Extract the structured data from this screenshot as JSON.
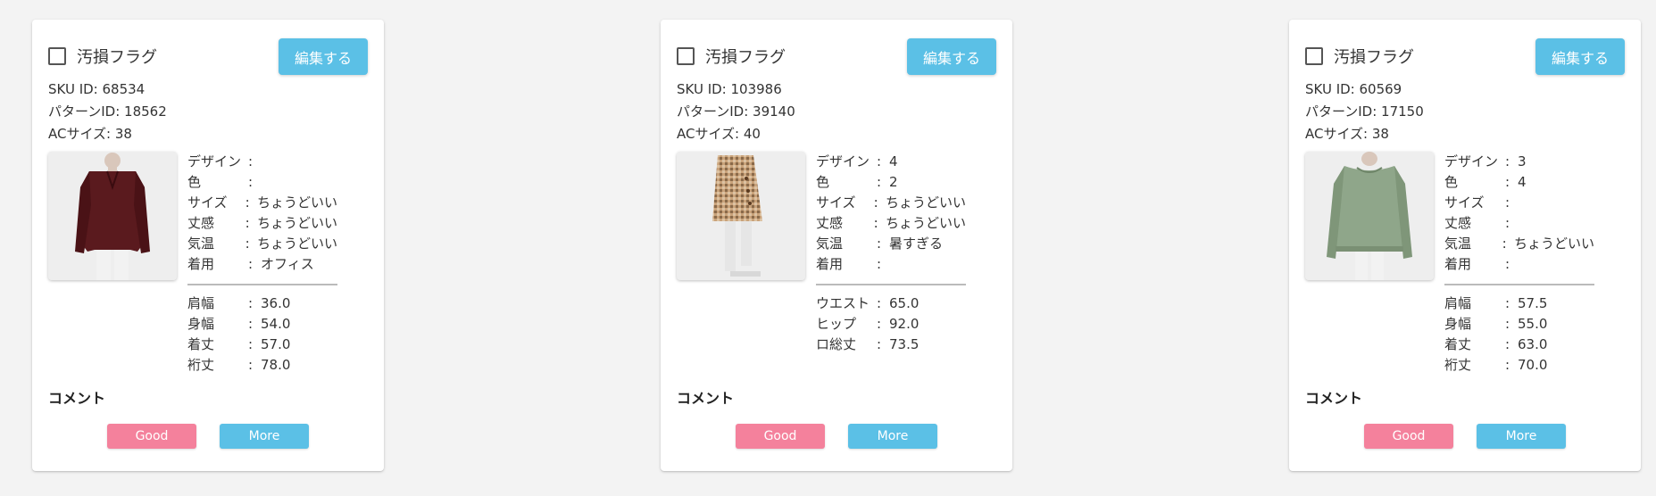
{
  "accent_colors": {
    "edit": "#5bc0e6",
    "good": "#f4819c",
    "more": "#5bc0e6"
  },
  "cards": [
    {
      "flag_label": "汚損フラグ",
      "flag_checked": false,
      "edit_label": "編集する",
      "sku": "SKU ID: 68534",
      "pattern": "パターンID: 18562",
      "ac_size": "ACサイズ: 38",
      "image": "burgundy-blouse-photo",
      "attributes": [
        {
          "key": "デザイン",
          "colon": ":",
          "value": ""
        },
        {
          "key": "色",
          "colon": ":",
          "value": ""
        },
        {
          "key": "サイズ",
          "colon": ":",
          "value": "ちょうどいい"
        },
        {
          "key": "丈感",
          "colon": ":",
          "value": "ちょうどいい"
        },
        {
          "key": "気温",
          "colon": ":",
          "value": "ちょうどいい"
        },
        {
          "key": "着用",
          "colon": ":",
          "value": "オフィス"
        }
      ],
      "measurements": [
        {
          "key": "肩幅",
          "colon": ":",
          "value": "36.0"
        },
        {
          "key": "身幅",
          "colon": ":",
          "value": "54.0"
        },
        {
          "key": "着丈",
          "colon": ":",
          "value": "57.0"
        },
        {
          "key": "裄丈",
          "colon": ":",
          "value": "78.0"
        }
      ],
      "comment_label": "コメント",
      "good_label": "Good",
      "more_label": "More"
    },
    {
      "flag_label": "汚損フラグ",
      "flag_checked": false,
      "edit_label": "編集する",
      "sku": "SKU ID: 103986",
      "pattern": "パターンID: 39140",
      "ac_size": "ACサイズ: 40",
      "image": "check-skirt-photo",
      "attributes": [
        {
          "key": "デザイン",
          "colon": ":",
          "value": "4"
        },
        {
          "key": "色",
          "colon": ":",
          "value": "2"
        },
        {
          "key": "サイズ",
          "colon": ":",
          "value": "ちょうどいい"
        },
        {
          "key": "丈感",
          "colon": ":",
          "value": "ちょうどいい"
        },
        {
          "key": "気温",
          "colon": ":",
          "value": "暑すぎる"
        },
        {
          "key": "着用",
          "colon": ":",
          "value": ""
        }
      ],
      "measurements": [
        {
          "key": "ウエスト",
          "colon": ":",
          "value": "65.0"
        },
        {
          "key": "ヒップ",
          "colon": ":",
          "value": "92.0"
        },
        {
          "key": "ロ総丈",
          "colon": ":",
          "value": "73.5"
        }
      ],
      "comment_label": "コメント",
      "good_label": "Good",
      "more_label": "More"
    },
    {
      "flag_label": "汚損フラグ",
      "flag_checked": false,
      "edit_label": "編集する",
      "sku": "SKU ID: 60569",
      "pattern": "パターンID: 17150",
      "ac_size": "ACサイズ: 38",
      "image": "sage-sweater-photo",
      "attributes": [
        {
          "key": "デザイン",
          "colon": ":",
          "value": "3"
        },
        {
          "key": "色",
          "colon": ":",
          "value": "4"
        },
        {
          "key": "サイズ",
          "colon": ":",
          "value": ""
        },
        {
          "key": "丈感",
          "colon": ":",
          "value": ""
        },
        {
          "key": "気温",
          "colon": ":",
          "value": "ちょうどいい"
        },
        {
          "key": "着用",
          "colon": ":",
          "value": ""
        }
      ],
      "measurements": [
        {
          "key": "肩幅",
          "colon": ":",
          "value": "57.5"
        },
        {
          "key": "身幅",
          "colon": ":",
          "value": "55.0"
        },
        {
          "key": "着丈",
          "colon": ":",
          "value": "63.0"
        },
        {
          "key": "裄丈",
          "colon": ":",
          "value": "70.0"
        }
      ],
      "comment_label": "コメント",
      "good_label": "Good",
      "more_label": "More"
    }
  ]
}
